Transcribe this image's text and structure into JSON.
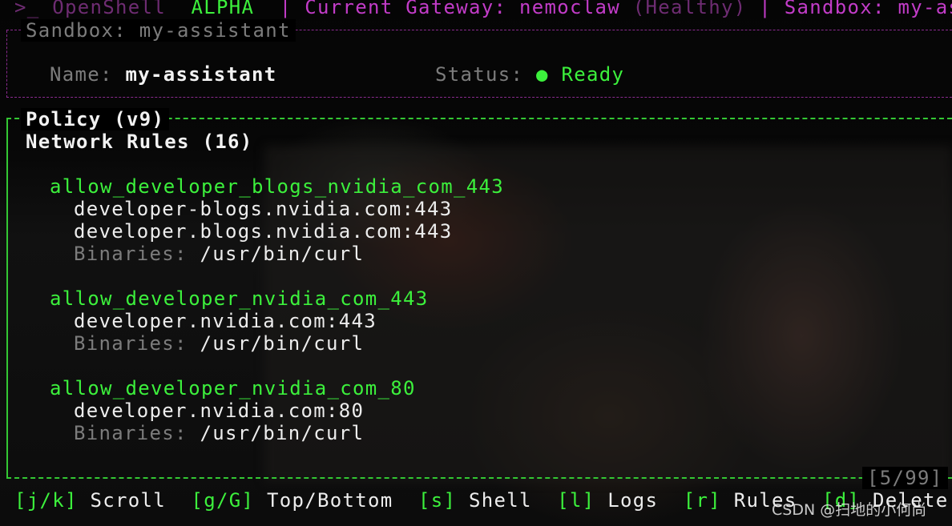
{
  "header": {
    "prompt": ">_",
    "app_name": "OpenShell",
    "badge": "ALPHA",
    "sep1": "|",
    "gateway_label": "Current Gateway:",
    "gateway_name": "nemoclaw",
    "gateway_status": "(Healthy)",
    "sep2": "|",
    "sandbox_label": "Sandbox:",
    "sandbox_name": "my-assis"
  },
  "sandbox_panel": {
    "title": "Sandbox: my-assistant",
    "name_label": "Name:",
    "name_value": "my-assistant",
    "status_label": "Status:",
    "status_dot": "●",
    "status_value": "Ready"
  },
  "policy_panel": {
    "title": "Policy (v9)",
    "section_heading": "Network Rules (16)",
    "rules": [
      {
        "name": "allow_developer_blogs_nvidia_com_443",
        "endpoints": [
          "developer-blogs.nvidia.com:443",
          "developer.blogs.nvidia.com:443"
        ],
        "binaries_label": "Binaries:",
        "binaries_value": "/usr/bin/curl"
      },
      {
        "name": "allow_developer_nvidia_com_443",
        "endpoints": [
          "developer.nvidia.com:443"
        ],
        "binaries_label": "Binaries:",
        "binaries_value": "/usr/bin/curl"
      },
      {
        "name": "allow_developer_nvidia_com_80",
        "endpoints": [
          "developer.nvidia.com:80"
        ],
        "binaries_label": "Binaries:",
        "binaries_value": "/usr/bin/curl"
      }
    ],
    "scroll_position": "[5/99]"
  },
  "footer": {
    "keys": [
      {
        "key": "[j/k]",
        "action": "Scroll"
      },
      {
        "key": "[g/G]",
        "action": "Top/Bottom"
      },
      {
        "key": "[s]",
        "action": "Shell"
      },
      {
        "key": "[l]",
        "action": "Logs"
      },
      {
        "key": "[r]",
        "action": "Rules"
      },
      {
        "key": "[d]",
        "action": "Delete"
      }
    ]
  },
  "watermark": "CSDN @扫地的小何尚",
  "colors": {
    "accent_purple": "#c23cc8",
    "accent_green": "#3cf03c",
    "dim_grey": "#7c7c7c"
  }
}
